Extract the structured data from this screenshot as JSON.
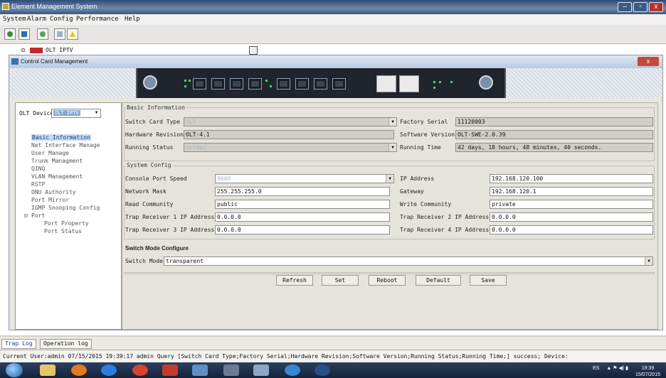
{
  "window": {
    "title": "Element Management System",
    "min": "–",
    "max": "▫",
    "close": "x"
  },
  "menubar": [
    "System",
    "Alarm",
    "Config",
    "Performance",
    "Help"
  ],
  "tree_top": "OLT IPTV",
  "dialog": {
    "title": "Control Card Management",
    "close": "x"
  },
  "left": {
    "device_label": "OLT Device",
    "device_value": "OLT IPTV",
    "items": [
      "Basic Information",
      "Net Interface Manage",
      "User Manage",
      "Trunk Managment",
      "QINQ",
      "VLAN Management",
      "RSTP",
      "ONU Authority",
      "Port Mirror",
      "IGMP Snooping Config",
      "Port",
      "Port Property",
      "Port Status"
    ]
  },
  "basic": {
    "section": "Basic Information",
    "switch_card_type_label": "Switch Card Type",
    "switch_card_type_value": "OLT",
    "factory_serial_label": "Factory Serial",
    "factory_serial_value": "11120003",
    "hw_rev_label": "Hardware Revision",
    "hw_rev_value": "OLT-4.1",
    "sw_ver_label": "Software Version",
    "sw_ver_value": "OLT-SWE-2.0.39",
    "running_status_label": "Running Status",
    "running_status_value": "normal",
    "running_time_label": "Running Time",
    "running_time_value": "42 days, 18 hours, 48 minutes, 40 seconds."
  },
  "system": {
    "section": "System Config",
    "console_label": "Console Port Speed",
    "console_value": "9600",
    "ip_label": "IP Address",
    "ip_value": "192.168.120.100",
    "mask_label": "Network Mask",
    "mask_value": "255.255.255.0",
    "gw_label": "Gateway",
    "gw_value": "192.168.120.1",
    "read_label": "Read Community",
    "read_value": "public",
    "write_label": "Write Community",
    "write_value": "private",
    "trap1_label": "Trap Receiver 1 IP Address",
    "trap1_value": "0.0.0.0",
    "trap2_label": "Trap Receiver 2 IP Address",
    "trap2_value": "0.0.0.0",
    "trap3_label": "Trap Receiver 3 IP Address",
    "trap3_value": "0.0.0.0",
    "trap4_label": "Trap Receiver 4 IP Address",
    "trap4_value": "0.0.0.0"
  },
  "switch_mode": {
    "section": "Switch Mode Configure",
    "label": "Switch Mode",
    "value": "transparent"
  },
  "buttons": {
    "refresh": "Refresh",
    "set": "Set",
    "reboot": "Reboot",
    "default": "Default",
    "save": "Save"
  },
  "tabs": [
    "Trap Log",
    "Operation log"
  ],
  "status_text": "Current User:admin   07/15/2015 19:39:17  admin  Query [Switch Card Type;Factory Serial;Hardware Revision;Software Version;Running Status;Running Time;] success; Device:",
  "taskbar": {
    "lang": "ES",
    "time": "19:39",
    "date": "15/07/2015"
  }
}
